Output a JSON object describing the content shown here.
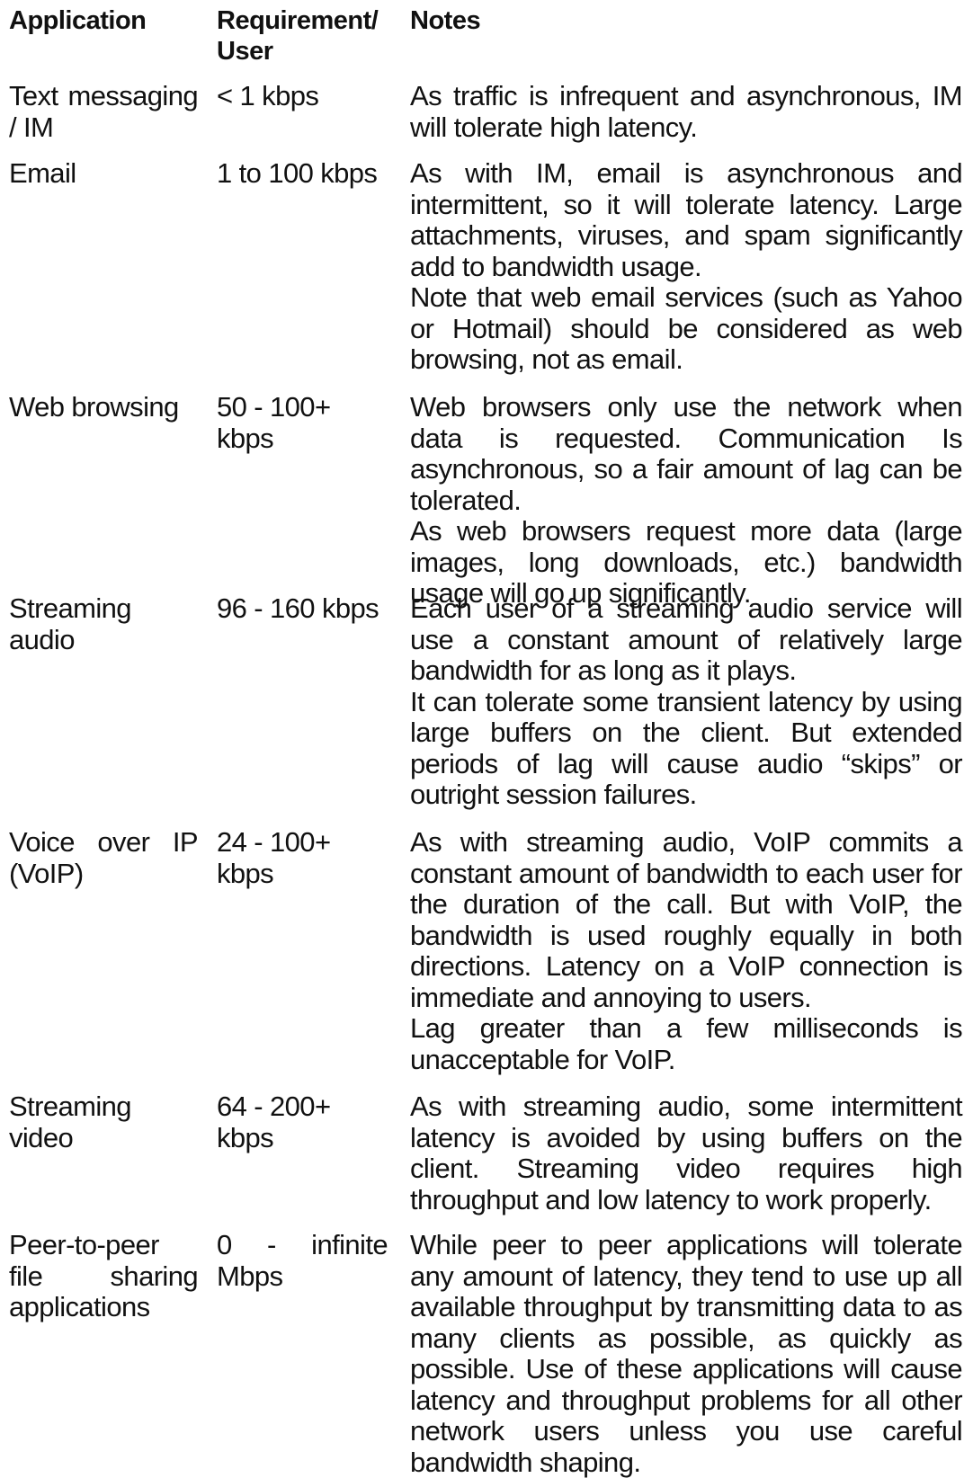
{
  "headers": {
    "application": "Application",
    "requirement": "Requirement/ User",
    "notes": "Notes"
  },
  "rows": [
    {
      "application": "Text messaging / IM",
      "requirement": "< 1 kbps",
      "notes": [
        "As traffic is infrequent and asynchronous, IM will tolerate high latency."
      ]
    },
    {
      "application": "Email",
      "requirement": "1 to 100 kbps",
      "notes": [
        "As with IM, email is asynchronous and intermittent, so it will tolerate latency. Large attachments, viruses, and spam significantly add to bandwidth usage.",
        "Note that web email services (such as Yahoo or Hotmail) should be considered as web browsing, not as email."
      ]
    },
    {
      "application": "Web browsing",
      "requirement": "50 - 100+ kbps",
      "notes": [
        "Web browsers only use the network when data is requested. Communication Is asynchronous, so a fair amount of lag can be tolerated.",
        "As web browsers request more data (large images, long downloads, etc.) bandwidth usage will go up significantly."
      ]
    },
    {
      "application": "Streaming audio",
      "requirement": "96 - 160 kbps",
      "notes": [
        "Each user of a streaming audio service will use a constant amount of relatively large bandwidth for as long as it plays.",
        "It can tolerate some transient latency by using large buffers on the client. But extended periods of lag will cause audio “skips” or outright session failures."
      ]
    },
    {
      "application": "Voice over IP (VoIP)",
      "requirement": "24 - 100+ kbps",
      "notes": [
        "As with streaming audio, VoIP commits a constant amount of bandwidth to each user for the duration of the call. But with VoIP, the bandwidth is used roughly equally in both directions. Latency on a VoIP connection is immediate and annoying to users.",
        "Lag greater than a few milliseconds is unacceptable for VoIP."
      ]
    },
    {
      "application": "Streaming video",
      "requirement": "64 - 200+ kbps",
      "notes": [
        "As with streaming audio, some intermittent latency is avoided by using buffers on the client. Streaming video requires high throughput and low latency to work properly."
      ]
    },
    {
      "application": "Peer-to-peer file sharing applications",
      "requirement": "0 - infinite Mbps",
      "notes": [
        "While peer to peer applications will tolerate any amount of latency, they tend to use up all available throughput by transmitting data to as many clients as possible, as quickly as possible. Use of these applications will cause latency and throughput problems for all other network users unless you use careful bandwidth shaping."
      ]
    }
  ]
}
